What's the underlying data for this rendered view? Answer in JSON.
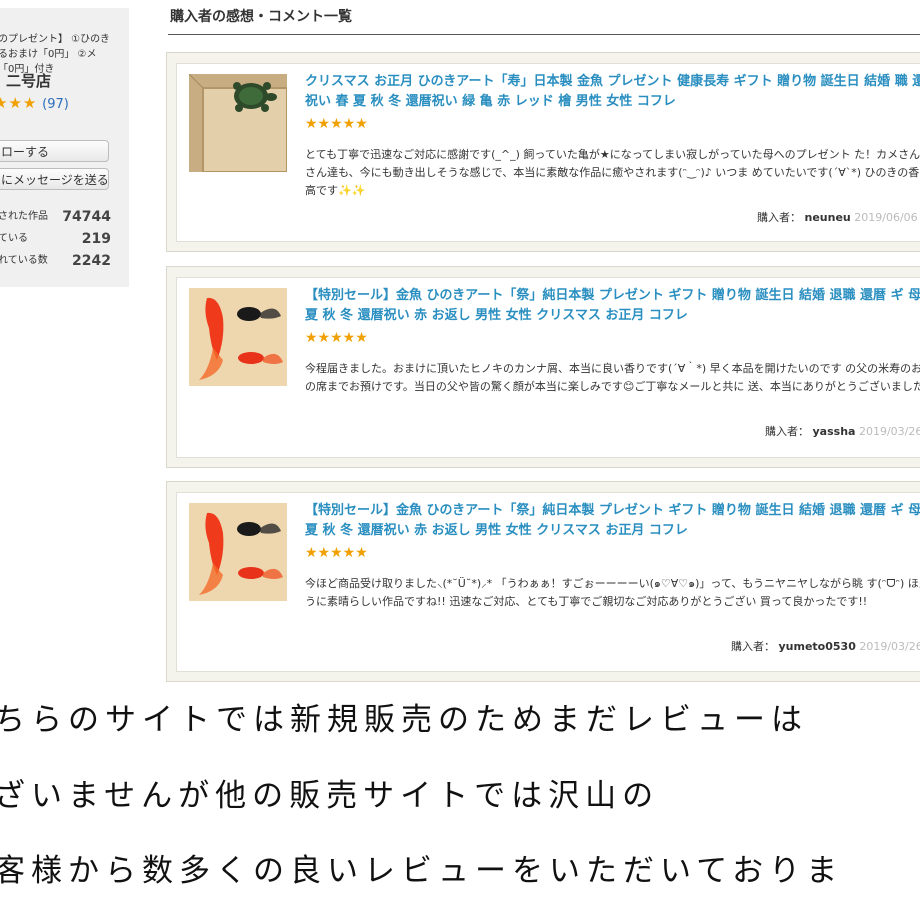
{
  "shop": {
    "promo_line1": "のプレゼント】 ①ひのき",
    "promo_line2": "るおまけ「0円」 ②メ",
    "promo_line3": "「0円」付き",
    "name": "二号店",
    "stars": "★★★",
    "rating_count": "(97)",
    "follow_label": "ローする",
    "message_label": "にメッセージを送る",
    "stats": [
      {
        "label": "された作品",
        "value": "74744"
      },
      {
        "label": "ている",
        "value": "219"
      },
      {
        "label": "れている数",
        "value": "2242"
      }
    ]
  },
  "section_title": "購入者の感想・コメント一覧",
  "reviews": [
    {
      "title": "クリスマス お正月 ひのきアート「寿」日本製 金魚 プレゼント 健康長寿 ギフト 贈り物 誕生日 結婚 職 還暦 祝い 春 夏 秋 冬 還暦祝い 緑 亀 赤 レッド 檜 男性 女性 コフレ",
      "stars": "★★★★★",
      "comment": "とても丁寧で迅速なご対応に感謝です(_^_) 飼っていた亀が★になってしまい寂しがっていた母へのプレゼント た！カメさんも金魚さん達も、今にも動き出しそうな感じで、本当に素敵な作品に癒やされます(ᵔ‿ᵔ)♪ いつま めていたいです(´∀`*) ひのきの香りも最高です✨✨",
      "buyer_label": "購入者：",
      "buyer": "neuneu",
      "date": "2019/06/06",
      "image": "turtle"
    },
    {
      "title": "【特別セール】金魚 ひのきアート「祭」純日本製 プレゼント ギフト 贈り物 誕生日 結婚 退職 還暦 ギ 母 春 夏 秋 冬 還暦祝い 赤 お返し 男性 女性 クリスマス お正月 コフレ",
      "stars": "★★★★★",
      "comment": "今程届きました。おまけに頂いたヒノキのカンナ屑、本当に良い香りです(´∀｀*) 早く本品を開けたいのです の父の米寿のお祝いの席までお預けです。当日の父や皆の驚く顔が本当に楽しみです😊ご丁寧なメールと共に 送、本当にありがとうございました。",
      "buyer_label": "購入者：",
      "buyer": "yassha",
      "date": "2019/03/26",
      "image": "goldfish"
    },
    {
      "title": "【特別セール】金魚 ひのきアート「祭」純日本製 プレゼント ギフト 贈り物 誕生日 結婚 退職 還暦 ギ 母 春 夏 秋 冬 還暦祝い 赤 お返し 男性 女性 クリスマス お正月 コフレ",
      "stars": "★★★★★",
      "comment": "今ほど商品受け取りました⸜(*˘Ü˘*)⸝* 「うわぁぁ！すごぉーーーーい(๑♡∀♡๑)」って、もうニヤニヤしながら眺 す(ᵔᗜᵔ) ほんっとうに素晴らしい作品ですね!! 迅速なご対応、とても丁寧でご親切なご対応ありがとうござい 買って良かったです!!",
      "buyer_label": "購入者：",
      "buyer": "yumeto0530",
      "date": "2019/03/26",
      "image": "goldfish"
    }
  ],
  "promo_text": [
    "ちらのサイトでは新規販売のためまだレビューは",
    "ざいませんが他の販売サイトでは沢山の",
    "客様から数多くの良いレビューをいただいておりま"
  ]
}
